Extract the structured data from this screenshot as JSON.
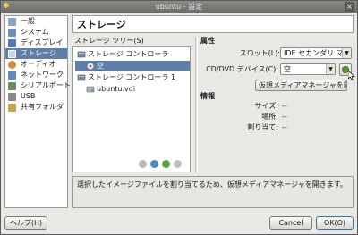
{
  "window": {
    "title": "ubuntu - 設定",
    "close_glyph": "×"
  },
  "sidebar": {
    "items": [
      {
        "label": "一般",
        "icon": "general-icon",
        "color": "#8aa4c8"
      },
      {
        "label": "システム",
        "icon": "system-icon",
        "color": "#6a8fbe"
      },
      {
        "label": "ディスプレイ",
        "icon": "display-icon",
        "color": "#4f78b4"
      },
      {
        "label": "ストレージ",
        "icon": "storage-icon",
        "color": "#c9d6e8",
        "selected": true
      },
      {
        "label": "オーディオ",
        "icon": "audio-icon",
        "color": "#d28a3c"
      },
      {
        "label": "ネットワーク",
        "icon": "network-icon",
        "color": "#5a8bc0"
      },
      {
        "label": "シリアルポート",
        "icon": "serial-port-icon",
        "color": "#6e8a5a"
      },
      {
        "label": "USB",
        "icon": "usb-icon",
        "color": "#888888"
      },
      {
        "label": "共有フォルダ",
        "icon": "shared-folder-icon",
        "color": "#c9a24a"
      }
    ]
  },
  "header": {
    "title": "ストレージ"
  },
  "tree": {
    "label": "ストレージ ツリー(S)",
    "rows": [
      {
        "label": "ストレージ コントローラ",
        "icon": "ide-controller-icon",
        "indent": 0
      },
      {
        "label": "空",
        "icon": "cd-dvd-icon",
        "indent": 1,
        "selected": true
      },
      {
        "label": "ストレージ コントローラ 1",
        "icon": "sata-controller-icon",
        "indent": 0
      },
      {
        "label": "ubuntu.vdi",
        "icon": "hard-disk-icon",
        "indent": 1
      }
    ],
    "tools": [
      "add-controller-icon",
      "add-attachment-icon",
      "remove-attachment-icon",
      "remove-controller-icon"
    ]
  },
  "attributes": {
    "title": "属性",
    "slot_label": "スロット(L):",
    "slot_value": "IDE セカンダリ マス",
    "cd_label": "CD/DVD デバイス(C):",
    "cd_value": "空",
    "vmm_button": "仮想メディアマネージャを開く"
  },
  "info": {
    "title": "情報",
    "size_label": "サイズ:",
    "size_value": "--",
    "location_label": "場所:",
    "location_value": "--",
    "attached_label": "割り当て:",
    "attached_value": "--"
  },
  "description": "選択したイメージファイルを割り当てるため、仮想メディアマネージャを開きます。",
  "buttons": {
    "help": "ヘルプ(H)",
    "cancel": "Cancel",
    "ok": "OK(O)"
  }
}
